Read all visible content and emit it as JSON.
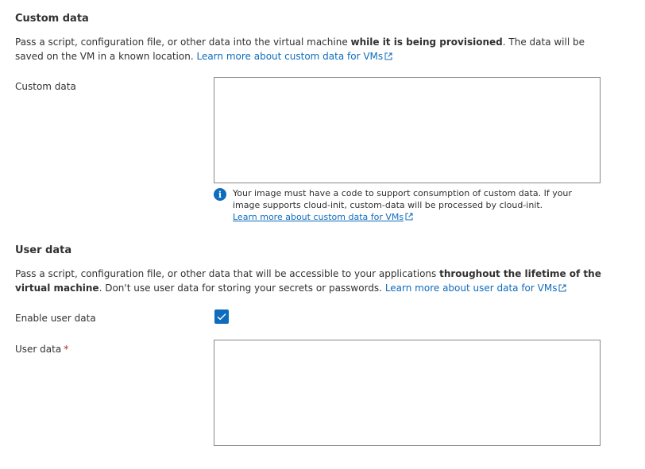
{
  "custom_data_section": {
    "title": "Custom data",
    "description_prefix": "Pass a script, configuration file, or other data into the virtual machine ",
    "description_bold": "while it is being provisioned",
    "description_suffix": ". The data will be saved on the VM in a known location. ",
    "learn_more_link": "Learn more about custom data for VMs",
    "field_label": "Custom data",
    "field_value": "",
    "info_text": "Your image must have a code to support consumption of custom data. If your image supports cloud-init, custom-data will be processed by cloud-init.",
    "info_link": "Learn more about custom data for VMs"
  },
  "user_data_section": {
    "title": "User data",
    "description_prefix": "Pass a script, configuration file, or other data that will be accessible to your applications ",
    "description_bold": "throughout the lifetime of the virtual machine",
    "description_suffix": ". Don't use user data for storing your secrets or passwords. ",
    "learn_more_link": "Learn more about user data for VMs",
    "enable_label": "Enable user data",
    "enable_checked": true,
    "field_label": "User data",
    "required_marker": "*",
    "field_value": ""
  },
  "icons": {
    "external_link": "external-link-icon",
    "info": "info-icon",
    "checkmark": "checkmark-icon"
  },
  "colors": {
    "accent": "#0f6cbd",
    "text": "#323130",
    "border": "#8a8886",
    "required": "#a4262c"
  }
}
